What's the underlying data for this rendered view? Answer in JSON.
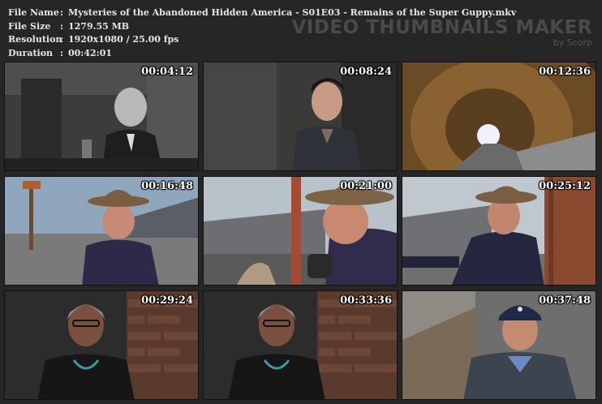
{
  "info": {
    "rows": [
      {
        "key": "File Name",
        "value": "Mysteries of the Abandoned Hidden America - S01E03 - Remains of the Super Guppy.mkv"
      },
      {
        "key": "File Size",
        "value": "1279.55 MB"
      },
      {
        "key": "Resolution",
        "value": "1920x1080 / 25.00 fps"
      },
      {
        "key": "Duration",
        "value": "00:42:01"
      }
    ]
  },
  "brand": {
    "title": "VIDEO THUMBNAILS MAKER",
    "subtitle": "by Scorp"
  },
  "thumbnails": [
    {
      "timestamp": "00:04:12"
    },
    {
      "timestamp": "00:08:24"
    },
    {
      "timestamp": "00:12:36"
    },
    {
      "timestamp": "00:16:48"
    },
    {
      "timestamp": "00:21:00"
    },
    {
      "timestamp": "00:25:12"
    },
    {
      "timestamp": "00:29:24"
    },
    {
      "timestamp": "00:33:36"
    },
    {
      "timestamp": "00:37:48"
    }
  ]
}
